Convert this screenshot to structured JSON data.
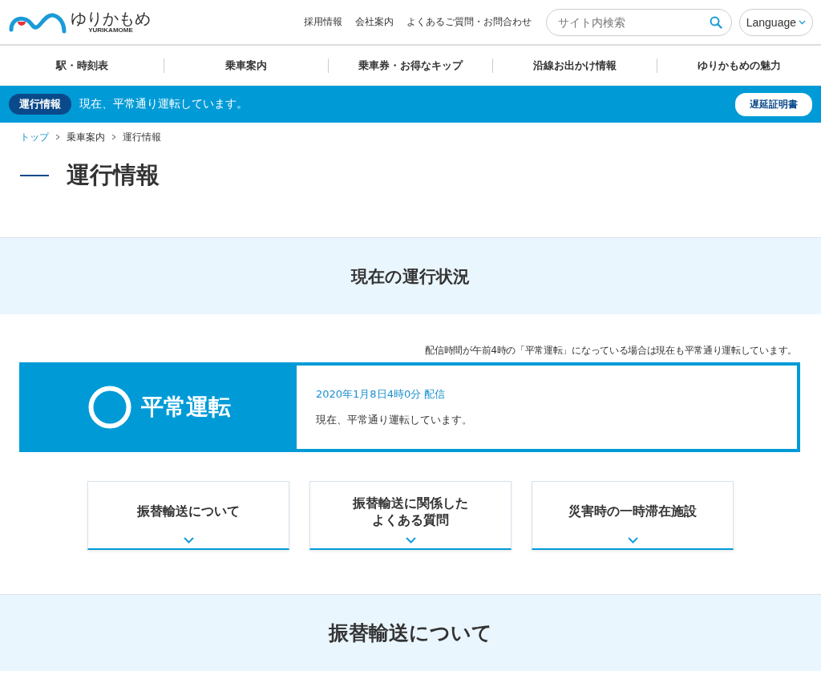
{
  "header": {
    "logo_text": "ゆりかもめ",
    "logo_sub": "YURIKAMOME",
    "links": [
      "採用情報",
      "会社案内",
      "よくあるご質問・お問合わせ"
    ],
    "search": {
      "placeholder": "サイト内検索"
    },
    "language": "Language"
  },
  "nav": [
    "駅・時刻表",
    "乗車案内",
    "乗車券・お得なキップ",
    "沿線お出かけ情報",
    "ゆりかもめの魅力"
  ],
  "info_bar": {
    "badge": "運行情報",
    "message": "現在、平常通り運転しています。",
    "button": "遅延証明書"
  },
  "breadcrumb": [
    {
      "label": "トップ",
      "link": true
    },
    {
      "label": "乗車案内",
      "link": false
    },
    {
      "label": "運行情報",
      "link": false
    }
  ],
  "page_title": "運行情報",
  "section_title": "現在の運行状況",
  "note": "配信時間が午前4時の「平常運転」になっている場合は現在も平常通り運転しています。",
  "status": {
    "kind": "normal",
    "label": "平常運転",
    "time": "2020年1月8日4時0分 配信",
    "message": "現在、平常通り運転しています。"
  },
  "cards": [
    {
      "lines": [
        "振替輸送について"
      ]
    },
    {
      "lines": [
        "振替輸送に関係した",
        "よくある質問"
      ]
    },
    {
      "lines": [
        "災害時の一時滞在施設"
      ]
    }
  ],
  "next_section_title": "振替輸送について"
}
